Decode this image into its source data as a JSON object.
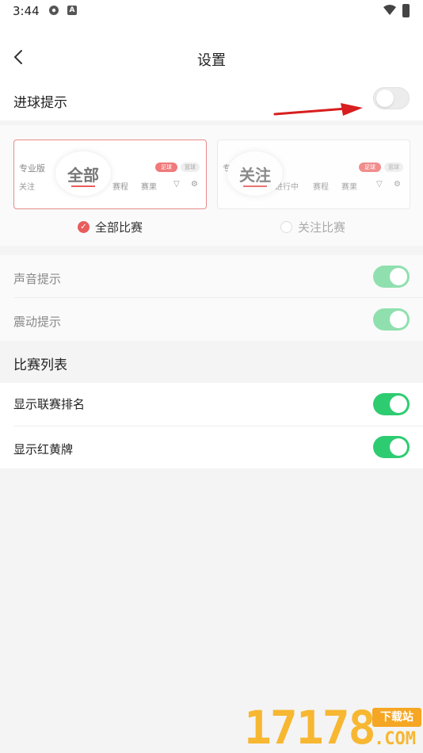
{
  "status_bar": {
    "time": "3:44"
  },
  "header": {
    "title": "设置"
  },
  "goal_alert": {
    "label": "进球提示",
    "enabled": false
  },
  "mode_cards": {
    "all": {
      "preview_title": "专业版",
      "preview_tab1": "关注",
      "preview_tab2": "赛程",
      "preview_tab3": "赛果",
      "badge_main": "足球",
      "badge_secondary": "篮球",
      "bubble": "全部"
    },
    "followed": {
      "preview_title": "专业版",
      "preview_tab1": "进行中",
      "preview_tab2": "赛程",
      "preview_tab3": "赛果",
      "badge_main": "足球",
      "badge_secondary": "篮球",
      "bubble": "关注"
    }
  },
  "mode_options": {
    "all": {
      "label": "全部比赛",
      "selected": true
    },
    "followed": {
      "label": "关注比赛",
      "selected": false
    }
  },
  "alerts": {
    "sound": {
      "label": "声音提示",
      "enabled": true
    },
    "vibrate": {
      "label": "震动提示",
      "enabled": true
    }
  },
  "match_list": {
    "section_title": "比赛列表",
    "show_rank": {
      "label": "显示联赛排名",
      "enabled": true
    },
    "show_cards": {
      "label": "显示红黄牌",
      "enabled": true
    }
  },
  "watermark": {
    "digits": "17178",
    "tag": "下载站",
    "suffix": ".COM"
  },
  "colors": {
    "accent_red": "#e85c5c",
    "toggle_green": "#2ecc71",
    "watermark_orange": "#f7b731"
  }
}
